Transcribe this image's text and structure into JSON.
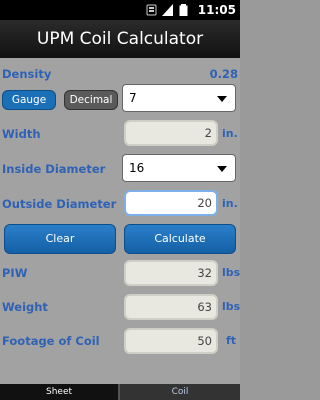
{
  "status_bar": {
    "time": "11:05"
  },
  "app": {
    "title": "UPM Coil Calculator"
  },
  "form": {
    "density": {
      "label": "Density",
      "value": "0.28"
    },
    "gauge_toggle": {
      "label": "Gauge",
      "selected": true
    },
    "decimal_toggle": {
      "label": "Decimal",
      "selected": false
    },
    "gauge_select": {
      "value": "7"
    },
    "width": {
      "label": "Width",
      "value": "2",
      "unit": "in."
    },
    "inside_diameter": {
      "label": "Inside Diameter",
      "value": "16"
    },
    "outside_diameter": {
      "label": "Outside Diameter",
      "value": "20",
      "unit": "in."
    },
    "clear_button": "Clear",
    "calculate_button": "Calculate",
    "piw": {
      "label": "PIW",
      "value": "32",
      "unit": "lbs"
    },
    "weight": {
      "label": "Weight",
      "value": "63",
      "unit": "lbs"
    },
    "footage": {
      "label": "Footage of Coil",
      "value": "50",
      "unit": "ft"
    }
  },
  "tabs": [
    {
      "label": "Sheet",
      "active": false
    },
    {
      "label": "Coil",
      "active": true
    }
  ]
}
